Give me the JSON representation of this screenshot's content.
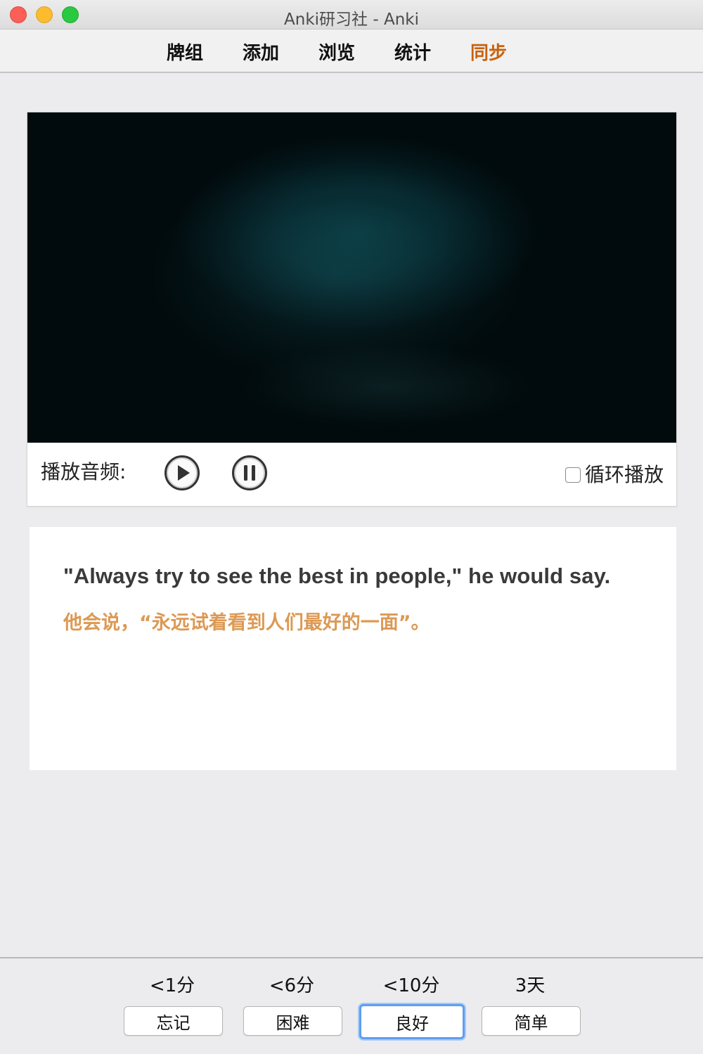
{
  "window": {
    "title": "Anki研习社 - Anki"
  },
  "toolbar": {
    "items": [
      {
        "label": "牌组"
      },
      {
        "label": "添加"
      },
      {
        "label": "浏览"
      },
      {
        "label": "统计"
      },
      {
        "label": "同步"
      }
    ],
    "sync_color": "#c8620f"
  },
  "player": {
    "audio_label": "播放音频:",
    "play_icon": "play-circle-icon",
    "pause_icon": "pause-circle-icon",
    "loop_label": "循环播放",
    "loop_checked": false
  },
  "card": {
    "english": "\"Always try to see the best in people,\" he would say.",
    "chinese": "他会说，“永远试着看到人们最好的一面”。",
    "chinese_color": "#dc9954"
  },
  "answers": [
    {
      "interval": "<1分",
      "label": "忘记"
    },
    {
      "interval": "<6分",
      "label": "困难"
    },
    {
      "interval": "<10分",
      "label": "良好",
      "default": true
    },
    {
      "interval": "3天",
      "label": "简单"
    }
  ]
}
